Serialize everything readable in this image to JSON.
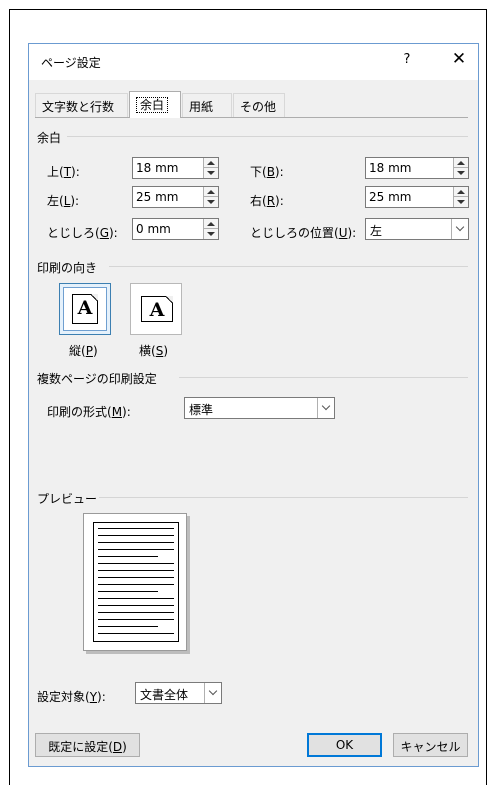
{
  "dialog": {
    "title": "ページ設定",
    "help": "?",
    "close": "✕"
  },
  "tabs": [
    {
      "label": "文字数と行数",
      "active": false
    },
    {
      "label": "余白",
      "active": true
    },
    {
      "label": "用紙",
      "active": false
    },
    {
      "label": "その他",
      "active": false
    }
  ],
  "margins": {
    "section": "余白",
    "top": {
      "label_pre": "上(",
      "key": "T",
      "label_post": "):",
      "value": "18 mm"
    },
    "bottom": {
      "label_pre": "下(",
      "key": "B",
      "label_post": "):",
      "value": "18 mm"
    },
    "left": {
      "label_pre": "左(",
      "key": "L",
      "label_post": "):",
      "value": "25 mm"
    },
    "right": {
      "label_pre": "右(",
      "key": "R",
      "label_post": "):",
      "value": "25 mm"
    },
    "gutter": {
      "label_pre": "とじしろ(",
      "key": "G",
      "label_post": "):",
      "value": "0 mm"
    },
    "gutter_position": {
      "label_pre": "とじしろの位置(",
      "key": "U",
      "label_post": "):",
      "value": "左"
    }
  },
  "orientation": {
    "section": "印刷の向き",
    "icon_letter": "A",
    "portrait": {
      "label_pre": "縦(",
      "key": "P",
      "label_post": ")",
      "selected": true
    },
    "landscape": {
      "label_pre": "横(",
      "key": "S",
      "label_post": ")",
      "selected": false
    }
  },
  "multiple_pages": {
    "section": "複数ページの印刷設定",
    "label_pre": "印刷の形式(",
    "key": "M",
    "label_post": "):",
    "value": "標準"
  },
  "preview": {
    "section": "プレビュー",
    "text_lines": 16
  },
  "apply_to": {
    "label_pre": "設定対象(",
    "key": "Y",
    "label_post": "):",
    "value": "文書全体"
  },
  "buttons": {
    "set_default_pre": "既定に設定(",
    "set_default_key": "D",
    "set_default_post": ")",
    "ok": "OK",
    "cancel": "キャンセル"
  },
  "colors": {
    "dialog_border": "#6b9bd1",
    "dialog_bg": "#f0f0f0",
    "selected_accent": "#3c7fb1",
    "default_button_border": "#0078d7"
  }
}
